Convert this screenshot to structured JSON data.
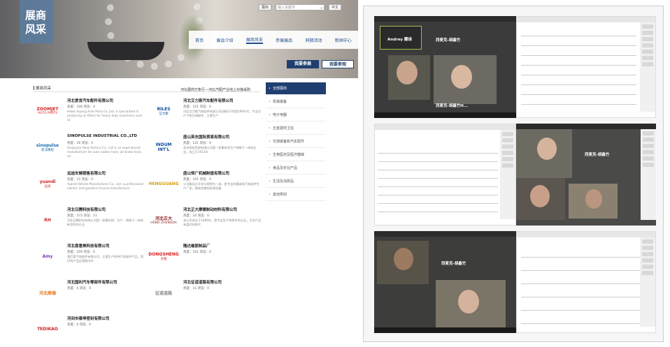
{
  "banner": {
    "title_line1": "展商",
    "title_line2": "风采"
  },
  "topbar": {
    "select": "展商",
    "search_placeholder": "输入关键字",
    "search_icon": "search-icon",
    "lang": "中文"
  },
  "nav": [
    "首页",
    "展会介绍",
    "展商风采",
    "参展展品",
    "同期活动",
    "新闻中心"
  ],
  "nav_active": 2,
  "buttons": {
    "exhibit": "我要参展",
    "visit": "我要参观"
  },
  "section": {
    "title": "展商风采",
    "tag": "河北展商万象行—河北汽配产业线上对接采购"
  },
  "exhibitors": [
    {
      "name": "河北爱肯汽车配件有限公司",
      "meta": "热度：106 浏览：0",
      "desc": "Hebei Aiyang Auto Parts Co.,Ltd. is specialized in producing air filters for heavy duty machinery such as",
      "logo": "ZOOMJET",
      "logo_sub": "AUTO PARTS",
      "logo_color": "#d32222"
    },
    {
      "name": "河北艾力斯汽车配件有限公司",
      "meta": "热度：121 浏览：0",
      "desc": "河北艾力斯汽车配件有限公司创建于20世纪90年代，专业生产汽车空调配件，主要生产",
      "logo": "RILES",
      "logo_sub": "艾力斯",
      "logo_color": "#0e4a9a"
    },
    {
      "name": "SINOPULSE INDUSTRIAL CO.,LTD",
      "meta": "热度：26 浏览：0",
      "desc": "Sinopulse Hose Factory Co., Ltd is an experienced manufacturer for auto rubber hose, air brake hose, air",
      "logo": "sinopulse",
      "logo_sub": "新派橡胶",
      "logo_color": "#1d6fb5"
    },
    {
      "name": "唐山英东国际贸易有限公司",
      "meta": "热度：121 浏览：0",
      "desc": "英东国际贸易有限公司是一家集研发生产销售于一体的企业，成立于2013年",
      "logo": "INDUM INT'L",
      "logo_sub": "",
      "logo_color": "#0e4a9a"
    },
    {
      "name": "远迪车辆销售有限公司",
      "meta": "热度：12 浏览：0",
      "desc": "Yuandi Vehicle Manufacturer Co., Ltd. a professional electric and gasoline tricycle manufacturer",
      "logo": "yuandi",
      "logo_sub": "远迪",
      "logo_color": "#d32222"
    },
    {
      "name": "唐山恒广机械制造有限公司",
      "meta": "热度：101 浏览：0",
      "desc": "公司集设计开发与营销为一体，是专业的模具和汽车配件生产厂家，拥有完善的检测设备",
      "logo": "HENGGUANG",
      "logo_sub": "",
      "logo_color": "#d4a017"
    },
    {
      "name": "河北日腾科技有限公司",
      "meta": "热度：372 浏览：11",
      "desc": "河北日腾科技有限公司是一家集科研、生产、销售于一体的新型科技企业",
      "logo": "RH",
      "logo_sub": "",
      "logo_color": "#d32222"
    },
    {
      "name": "河北正大摩擦制动材料有限公司",
      "meta": "热度：10 浏览：0",
      "desc": "本公司成立于1986年，是专业生产刹车片的企业，主导产品有盘式刹车片",
      "logo": "河北正大",
      "logo_sub": "HEBEI ZHENGDA",
      "logo_color": "#8a1c1c"
    },
    {
      "name": "河北恩意美科技有限公司",
      "meta": "热度：209 浏览：0",
      "desc": "我们是汽车配件有限公司，主要生产各种汽车配件产品，我们的产品远销国内外",
      "logo": "Amy",
      "logo_sub": "",
      "logo_color": "#7a3fb0"
    },
    {
      "name": "隆达橡胶制品厂",
      "meta": "热度：161 浏览：0",
      "desc": "",
      "logo": "DONGSHENG",
      "logo_sub": "东胜",
      "logo_color": "#d32222"
    },
    {
      "name": "河北国利汽车零部件有限公司",
      "meta": "热度：6 浏览：0",
      "desc": "",
      "logo": "河北鼎德",
      "logo_sub": "",
      "logo_color": "#e87a1a"
    },
    {
      "name": "河北征道道路有限公司",
      "meta": "热度：11 浏览：0",
      "desc": "",
      "logo": "征道道路",
      "logo_sub": "",
      "logo_color": "#888"
    },
    {
      "name": "河间市泰坤密封有限公司",
      "meta": "热度：6 浏览：0",
      "desc": "",
      "logo": "TEDIKAO",
      "logo_sub": "",
      "logo_color": "#d32222"
    }
  ],
  "categories": [
    "全部展商",
    "机械装备",
    "电子电器",
    "五金建材卫浴",
    "交通装备和汽车配件",
    "生物医药及医疗器械",
    "食品及农业产品",
    "生活及消费品",
    "其他类别"
  ],
  "collage": {
    "tile1_name_tag": "Andrey 翻译",
    "tile1_center": "西麦克-胡鑫竹",
    "tile1_bottom": "西麦克-胡鑫竹H...",
    "tile4_label": "西麦克-胡鑫竹",
    "tile5_label": "西麦克-胡鑫竹"
  }
}
